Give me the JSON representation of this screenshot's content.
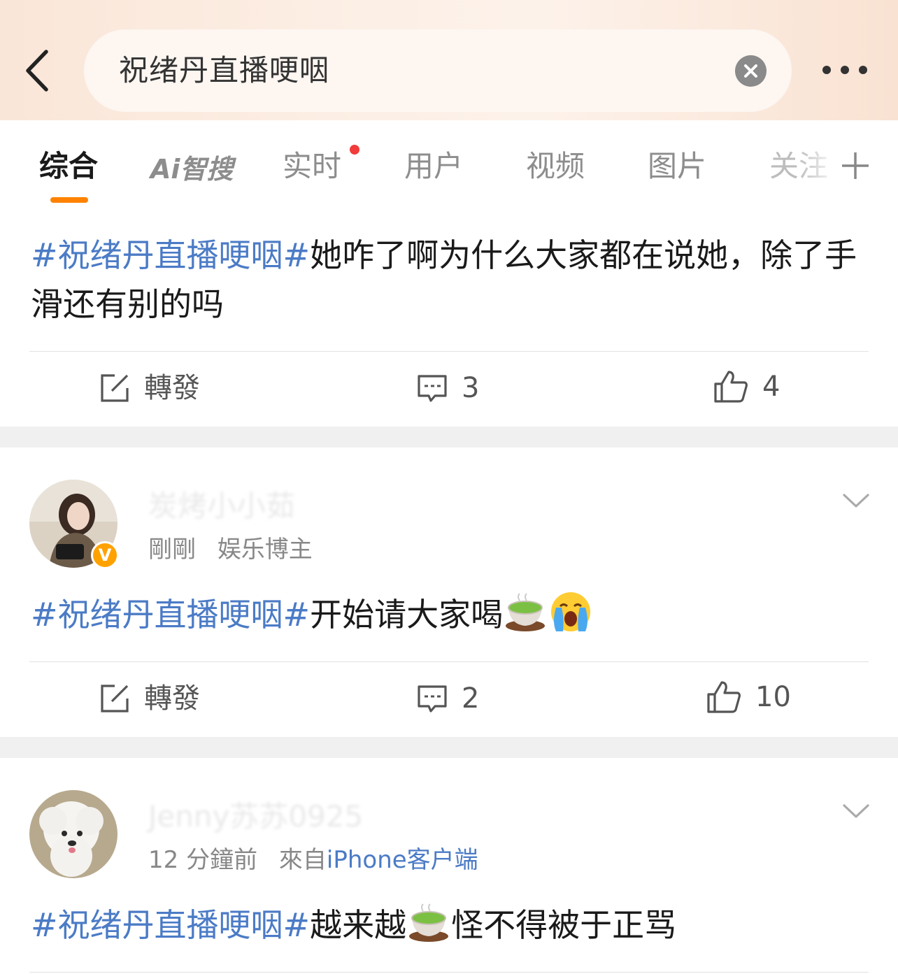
{
  "search": {
    "query": "祝绪丹直播哽咽"
  },
  "tabs": [
    {
      "label": "综合",
      "active": true
    },
    {
      "label": "Ai智搜"
    },
    {
      "label": "实时",
      "dot": true
    },
    {
      "label": "用户"
    },
    {
      "label": "视频"
    },
    {
      "label": "图片"
    },
    {
      "label": "关注"
    }
  ],
  "colors": {
    "accent": "#ff8200",
    "link": "#4b7bc6",
    "verified": "#ffa200",
    "dot": "#f23b3b"
  },
  "posts": [
    {
      "hashtag": "#祝绪丹直播哽咽#",
      "text": "她咋了啊为什么大家都在说她，除了手滑还有别的吗",
      "repost_label": "轉發",
      "comments": "3",
      "likes": "4"
    },
    {
      "username": "炭烤小小茹",
      "time": "剛剛",
      "tag": "娱乐博主",
      "verified": true,
      "hashtag": "#祝绪丹直播哽咽#",
      "text": "开始请大家喝",
      "emojis": [
        "tea-emoji",
        "crying-emoji"
      ],
      "repost_label": "轉發",
      "comments": "2",
      "likes": "10"
    },
    {
      "username": "Jenny苏苏0925",
      "time": "12 分鐘前",
      "source_prefix": "來自",
      "source": "iPhone客户端",
      "hashtag": "#祝绪丹直播哽咽#",
      "text_before": "越来越",
      "emoji": "tea-emoji",
      "text_after": "怪不得被于正骂"
    }
  ]
}
